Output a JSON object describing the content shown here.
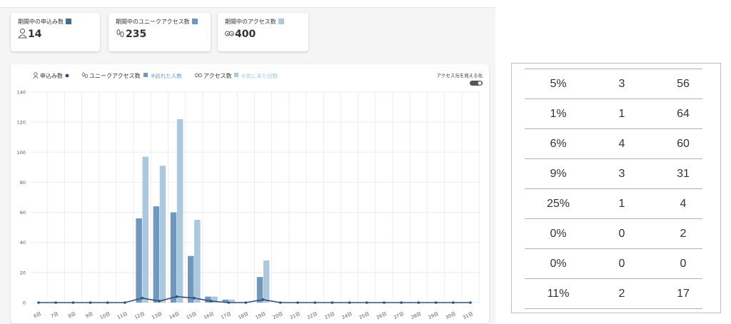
{
  "summary_cards": [
    {
      "label": "期間中の申込み数",
      "value": "14",
      "color": "#4a6a8e",
      "icon": "person-icon"
    },
    {
      "label": "期間中のユニークアクセス数",
      "value": "235",
      "color": "#6f98bc",
      "icon": "footprints-icon"
    },
    {
      "label": "期間中のアクセス数",
      "value": "400",
      "color": "#abc8dc",
      "icon": "eyes-icon"
    }
  ],
  "legend": {
    "applications": "申込み数",
    "unique_access": "ユニークアクセス数",
    "unique_note": "※訪れた人数",
    "access": "アクセス数",
    "access_note": "※見に来た回数"
  },
  "toggle_label": "アクセス元を見える化",
  "colors": {
    "line": "#34507a",
    "unique_bar": "#6f98bc",
    "access_bar": "#abc8dc",
    "grid": "#e6e6e6"
  },
  "chart_data": {
    "type": "bar",
    "title": "",
    "xlabel": "",
    "ylabel": "",
    "ylim": [
      0,
      140
    ],
    "yticks": [
      0,
      20,
      40,
      60,
      80,
      100,
      120,
      140
    ],
    "grid": true,
    "legend_position": "top-left",
    "categories": [
      "6日",
      "7日",
      "8日",
      "9日",
      "10日",
      "11日",
      "12日",
      "13日",
      "14日",
      "15日",
      "16日",
      "17日",
      "18日",
      "19日",
      "20日",
      "21日",
      "22日",
      "23日",
      "24日",
      "25日",
      "26日",
      "27日",
      "28日",
      "29日",
      "30日",
      "31日"
    ],
    "series": [
      {
        "name": "申込み数",
        "type": "line",
        "values": [
          0,
          0,
          0,
          0,
          0,
          0,
          3,
          1,
          4,
          3,
          1,
          0,
          0,
          2,
          0,
          0,
          0,
          0,
          0,
          0,
          0,
          0,
          0,
          0,
          0,
          0
        ]
      },
      {
        "name": "ユニークアクセス数",
        "type": "bar",
        "values": [
          0,
          0,
          0,
          0,
          0,
          0,
          56,
          64,
          60,
          31,
          4,
          2,
          0,
          17,
          0,
          0,
          0,
          0,
          0,
          0,
          0,
          0,
          0,
          0,
          0,
          0
        ]
      },
      {
        "name": "アクセス数",
        "type": "bar",
        "values": [
          0,
          0,
          0,
          0,
          0,
          0,
          97,
          91,
          122,
          55,
          4,
          2,
          0,
          28,
          0,
          0,
          0,
          0,
          0,
          0,
          0,
          0,
          0,
          0,
          0,
          0
        ]
      }
    ]
  },
  "table_rows": [
    [
      "5%",
      "3",
      "56"
    ],
    [
      "1%",
      "1",
      "64"
    ],
    [
      "6%",
      "4",
      "60"
    ],
    [
      "9%",
      "3",
      "31"
    ],
    [
      "25%",
      "1",
      "4"
    ],
    [
      "0%",
      "0",
      "2"
    ],
    [
      "0%",
      "0",
      "0"
    ],
    [
      "11%",
      "2",
      "17"
    ]
  ]
}
